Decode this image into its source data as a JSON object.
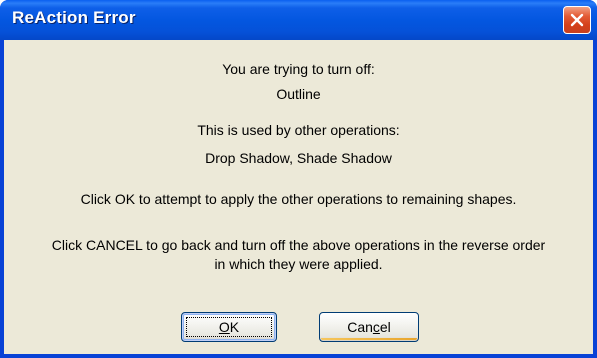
{
  "window": {
    "title": "ReAction Error"
  },
  "message": {
    "line1": "You are trying to turn off:",
    "line2": "Outline",
    "line3": "This is used by other operations:",
    "line4": "Drop Shadow, Shade Shadow",
    "line5": "Click OK to attempt to apply the other operations to remaining shapes.",
    "line6": "Click CANCEL to go back and turn off the above operations in the reverse order",
    "line7": "in which they were applied."
  },
  "buttons": {
    "ok": {
      "mnemonic": "O",
      "rest": "K"
    },
    "cancel": {
      "before": "Can",
      "mnemonic": "c",
      "after": "el"
    }
  },
  "colors": {
    "titlebar": "#0457e0",
    "client": "#ece9d8",
    "close_button": "#d4401a"
  }
}
